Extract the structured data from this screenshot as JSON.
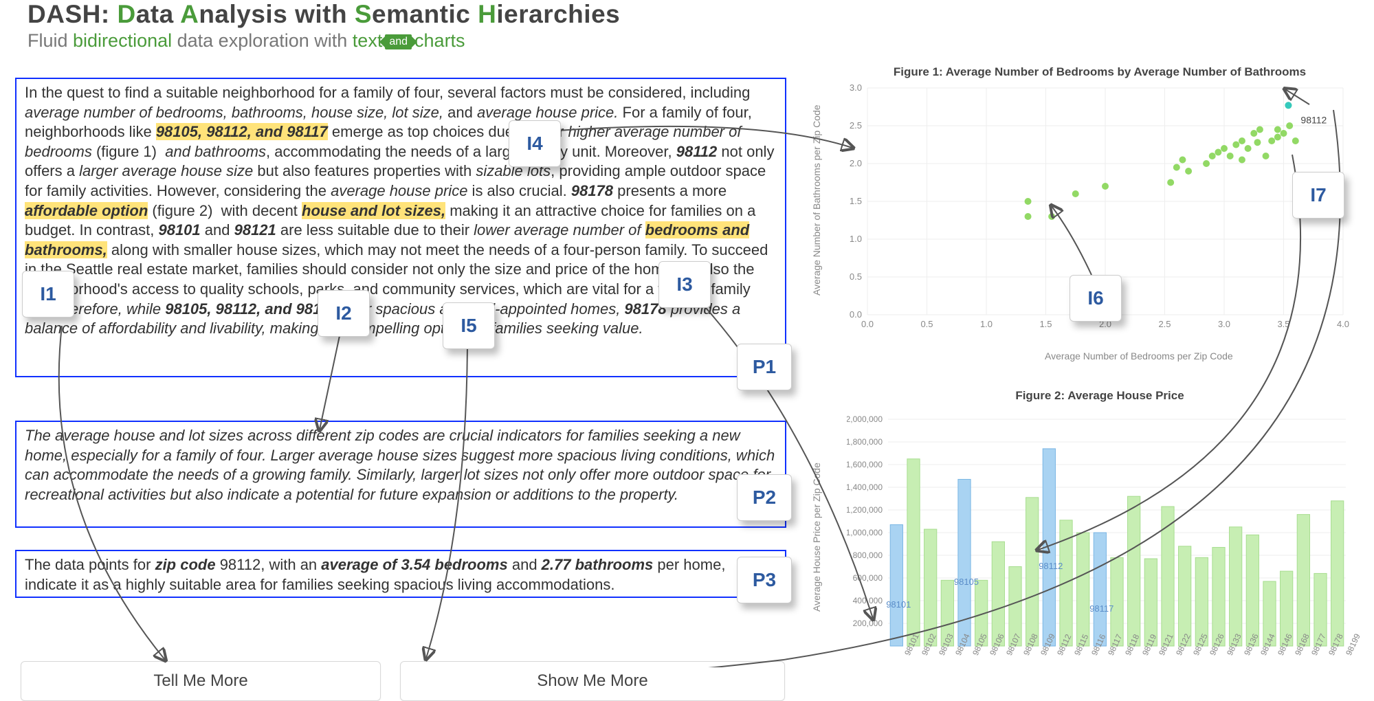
{
  "header": {
    "title_plain": "DASH: Data Analysis with Semantic Hierarchies",
    "title_parts": [
      "DASH: ",
      "D",
      "ata ",
      "A",
      "nalysis with ",
      "S",
      "emantic ",
      "H",
      "ierarchies"
    ],
    "sub_pre": "Fluid ",
    "sub_bi": "bidirectional",
    "sub_mid": " data exploration with ",
    "sub_text": "text",
    "sub_and": "and",
    "sub_charts": "charts"
  },
  "paragraphs": {
    "p1_html": " In the quest to find a suitable neighborhood for a family of four, several factors must be considered, including <i>average number of bedrooms, bathrooms, house size, lot size,</i> and <i>average house price.</i> For a family of four, neighborhoods like <span class='hl'><i>98105, 98112, and 98117</i></span> emerge as top choices due to their <i>higher average number of bedrooms</i> (figure 1)&nbsp; <i>and bathrooms</i>, accommodating the needs of a larger family unit. Moreover, <b><i>98112</i></b> not only offers a <i>larger average house size</i> but also features properties with <i>sizable lots</i>, providing ample outdoor space for family activities. However, considering the <i>average house price</i> is also crucial. <b><i>98178</i></b> presents a more <span class='hl'><i>affordable option</i></span> (figure 2)&nbsp; with decent <span class='hl'><i>house and lot sizes,</i></span> making it an attractive choice for families on a budget. In contrast, <b><i>98101</i></b> and <b><i>98121</i></b> are less suitable due to their <i>lower average number of</i> <span class='hl'><i>bedrooms and bathrooms,</i></span> along with smaller house sizes, which may not meet the needs of a four-person family. To succeed in the Seattle real estate market, families should consider not only the size and price of the home but also the neighborhood's access to quality schools, parks, and community services, which are vital for a thriving family life. <i>Therefore, while <b>98105, 98112, and 98117</b> offer spacious and well-appointed homes, <b>98178</b> provides a balance of affordability and livability, making it a compelling option for families seeking value.</i>",
    "p2_html": "<i>The average house and lot sizes across different zip codes are crucial indicators for families seeking a new home, especially for a family of four. Larger average house sizes suggest more spacious living conditions, which can accommodate the needs of a growing family. Similarly, larger lot sizes not only offer more outdoor space for recreational activities but also indicate a potential for future expansion or additions to the property.</i>",
    "p3_html": " The data points for <b><i>zip code</i></b> 98112, with an <b><i>average of 3.54 bedrooms</i></b> and <b><i>2.77 bathrooms</i></b> per home, indicate it as a highly suitable area for families seeking spacious living accommodations."
  },
  "buttons": {
    "tell": "Tell Me More",
    "show": "Show Me More"
  },
  "badges": {
    "i1": "I1",
    "i2": "I2",
    "i3": "I3",
    "i4": "I4",
    "i5": "I5",
    "i6": "I6",
    "i7": "I7",
    "p1": "P1",
    "p2": "P2",
    "p3": "P3"
  },
  "chart_data": [
    {
      "id": "fig1",
      "type": "scatter",
      "title": "Figure 1: Average Number of Bedrooms by Average Number of Bathrooms",
      "xlabel": "Average Number of Bedrooms per Zip Code",
      "ylabel": "Average Number of Bathrooms per Zip Code",
      "xlim": [
        0,
        4
      ],
      "ylim": [
        0,
        3
      ],
      "xticks": [
        0,
        0.5,
        1.0,
        1.5,
        2.0,
        2.5,
        3.0,
        3.5,
        4.0
      ],
      "yticks": [
        0,
        0.5,
        1.0,
        1.5,
        2.0,
        2.5,
        3.0
      ],
      "annotate": {
        "label": "98112",
        "x": 3.54,
        "y": 2.77
      },
      "points": [
        [
          1.35,
          1.3
        ],
        [
          1.55,
          1.3
        ],
        [
          1.35,
          1.5
        ],
        [
          1.75,
          1.6
        ],
        [
          2.0,
          1.7
        ],
        [
          2.55,
          1.75
        ],
        [
          2.6,
          1.95
        ],
        [
          2.7,
          1.9
        ],
        [
          2.65,
          2.05
        ],
        [
          2.85,
          2.0
        ],
        [
          2.9,
          2.1
        ],
        [
          2.95,
          2.15
        ],
        [
          3.0,
          2.2
        ],
        [
          3.05,
          2.1
        ],
        [
          3.1,
          2.25
        ],
        [
          3.15,
          2.3
        ],
        [
          3.15,
          2.05
        ],
        [
          3.2,
          2.2
        ],
        [
          3.25,
          2.4
        ],
        [
          3.28,
          2.28
        ],
        [
          3.3,
          2.45
        ],
        [
          3.35,
          2.1
        ],
        [
          3.4,
          2.3
        ],
        [
          3.45,
          2.45
        ],
        [
          3.45,
          2.35
        ],
        [
          3.5,
          2.4
        ],
        [
          3.54,
          2.77
        ],
        [
          3.55,
          2.5
        ],
        [
          3.6,
          2.3
        ]
      ]
    },
    {
      "id": "fig2",
      "type": "bar",
      "title": "Figure 2: Average House Price",
      "ylabel": "Average House Price per Zip Code",
      "ylim": [
        0,
        2000000
      ],
      "yticks": [
        200000,
        400000,
        600000,
        800000,
        1000000,
        1200000,
        1400000,
        1600000,
        1800000,
        2000000
      ],
      "ytick_labels": [
        "200,000",
        "400,000",
        "600,000",
        "800,000",
        "1,000,000",
        "1,200,000",
        "1,400,000",
        "1,600,000",
        "1,800,000",
        "2,000,000"
      ],
      "highlight": [
        "98101",
        "98105",
        "98112",
        "98117"
      ],
      "series": [
        {
          "cat": "98101",
          "v": 1070000
        },
        {
          "cat": "98102",
          "v": 1650000
        },
        {
          "cat": "98103",
          "v": 1030000
        },
        {
          "cat": "98104",
          "v": 580000
        },
        {
          "cat": "98105",
          "v": 1470000
        },
        {
          "cat": "98106",
          "v": 580000
        },
        {
          "cat": "98107",
          "v": 920000
        },
        {
          "cat": "98108",
          "v": 700000
        },
        {
          "cat": "98109",
          "v": 1310000
        },
        {
          "cat": "98112",
          "v": 1740000
        },
        {
          "cat": "98115",
          "v": 1110000
        },
        {
          "cat": "98116",
          "v": 1000000
        },
        {
          "cat": "98117",
          "v": 1000000
        },
        {
          "cat": "98118",
          "v": 780000
        },
        {
          "cat": "98119",
          "v": 1320000
        },
        {
          "cat": "98121",
          "v": 770000
        },
        {
          "cat": "98122",
          "v": 1230000
        },
        {
          "cat": "98125",
          "v": 880000
        },
        {
          "cat": "98126",
          "v": 780000
        },
        {
          "cat": "98133",
          "v": 870000
        },
        {
          "cat": "98136",
          "v": 1050000
        },
        {
          "cat": "98144",
          "v": 980000
        },
        {
          "cat": "98146",
          "v": 570000
        },
        {
          "cat": "98168",
          "v": 660000
        },
        {
          "cat": "98177",
          "v": 1160000
        },
        {
          "cat": "98178",
          "v": 640000
        },
        {
          "cat": "98199",
          "v": 1280000
        }
      ]
    }
  ]
}
